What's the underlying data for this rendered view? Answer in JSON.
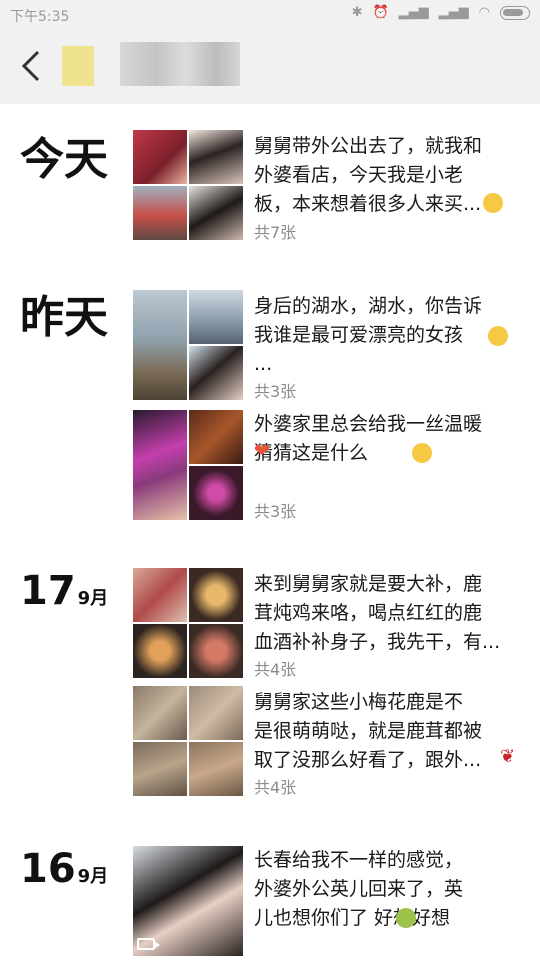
{
  "status_bar": {
    "time": "下午5:35",
    "icons": [
      "bluetooth-icon",
      "alarm-icon",
      "signal-icon",
      "signal-icon",
      "wifi-icon",
      "battery-icon"
    ]
  },
  "header": {
    "back_icon": "chevron-left-icon"
  },
  "days": [
    {
      "label": "今天"
    },
    {
      "label": "昨天"
    },
    {
      "num": "17",
      "month": "9月"
    },
    {
      "num": "16",
      "month": "9月"
    }
  ],
  "posts": [
    {
      "text": "舅舅带外公出去了，就我和\n外婆看店，今天我是小老\n板，本来想着很多人来买...",
      "count": "共7张"
    },
    {
      "text": "身后的湖水，湖水，你告诉\n我谁是最可爱漂亮的女孩\n...",
      "count": "共3张"
    },
    {
      "text": "外婆家里总会给我一丝温暖\n猜猜这是什么",
      "count": "共3张"
    },
    {
      "text": "来到舅舅家就是要大补，鹿\n茸炖鸡来咯，喝点红红的鹿\n血酒补补身子，我先干，有...",
      "count": "共4张"
    },
    {
      "text": "舅舅家这些小梅花鹿是不\n是很萌萌哒，就是鹿茸都被\n取了没那么好看了，跟外...",
      "count": "共4张"
    },
    {
      "text": "长春给我不一样的感觉，\n外婆外公英儿回来了，英\n儿也想你们了 好想好想",
      "count": ""
    }
  ],
  "colors": {
    "status_bg": "#f1f1f1",
    "count_text": "#8c8c8c",
    "blur_yellow": "#f0e38f"
  }
}
